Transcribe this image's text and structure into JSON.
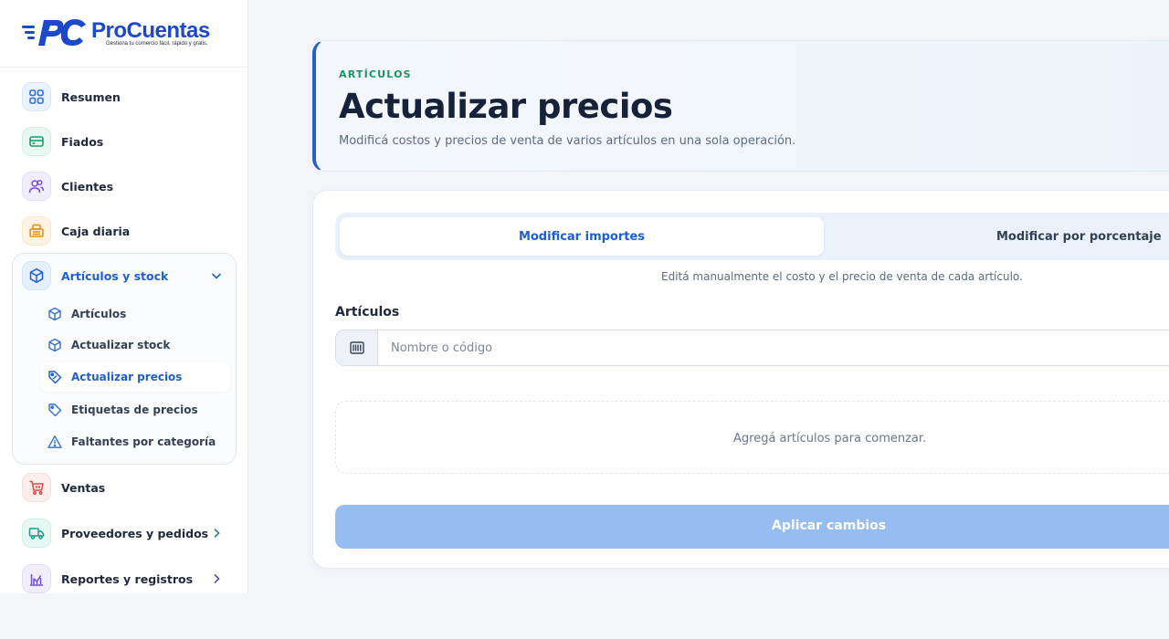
{
  "brand": {
    "name": "ProCuentas",
    "tagline": "Gestiona tu comercio fácil, rápido y gratis."
  },
  "sidebar": {
    "items": [
      {
        "label": "Resumen",
        "icon": "grid-icon"
      },
      {
        "label": "Fiados",
        "icon": "credit-card-icon"
      },
      {
        "label": "Clientes",
        "icon": "users-icon"
      },
      {
        "label": "Caja diaria",
        "icon": "register-icon"
      },
      {
        "label": "Artículos y stock",
        "icon": "box-icon",
        "expanded": true
      },
      {
        "label": "Ventas",
        "icon": "cart-icon"
      },
      {
        "label": "Proveedores y pedidos",
        "icon": "truck-icon"
      },
      {
        "label": "Reportes y registros",
        "icon": "chart-icon"
      }
    ],
    "subitems": [
      {
        "label": "Artículos",
        "icon": "box-icon"
      },
      {
        "label": "Actualizar stock",
        "icon": "box-icon"
      },
      {
        "label": "Actualizar precios",
        "icon": "tag-icon",
        "active": true
      },
      {
        "label": "Etiquetas de precios",
        "icon": "tag-icon"
      },
      {
        "label": "Faltantes por categoría",
        "icon": "warning-icon"
      }
    ]
  },
  "header": {
    "kicker": "ARTÍCULOS",
    "title": "Actualizar precios",
    "subtitle": "Modificá costos y precios de venta de varios artículos en una sola operación."
  },
  "tabs": [
    {
      "label": "Modificar importes",
      "active": true
    },
    {
      "label": "Modificar por porcentaje",
      "active": false
    }
  ],
  "tab_hint": "Editá manualmente el costo y el precio de venta de cada artículo.",
  "articles": {
    "label": "Artículos",
    "placeholder": "Nombre o código",
    "value": "",
    "empty_message": "Agregá artículos para comenzar."
  },
  "apply_button": "Aplicar cambios",
  "colors": {
    "accent": "#1d5fd1",
    "kicker": "#16975f",
    "apply_disabled": "#96bdf1"
  }
}
